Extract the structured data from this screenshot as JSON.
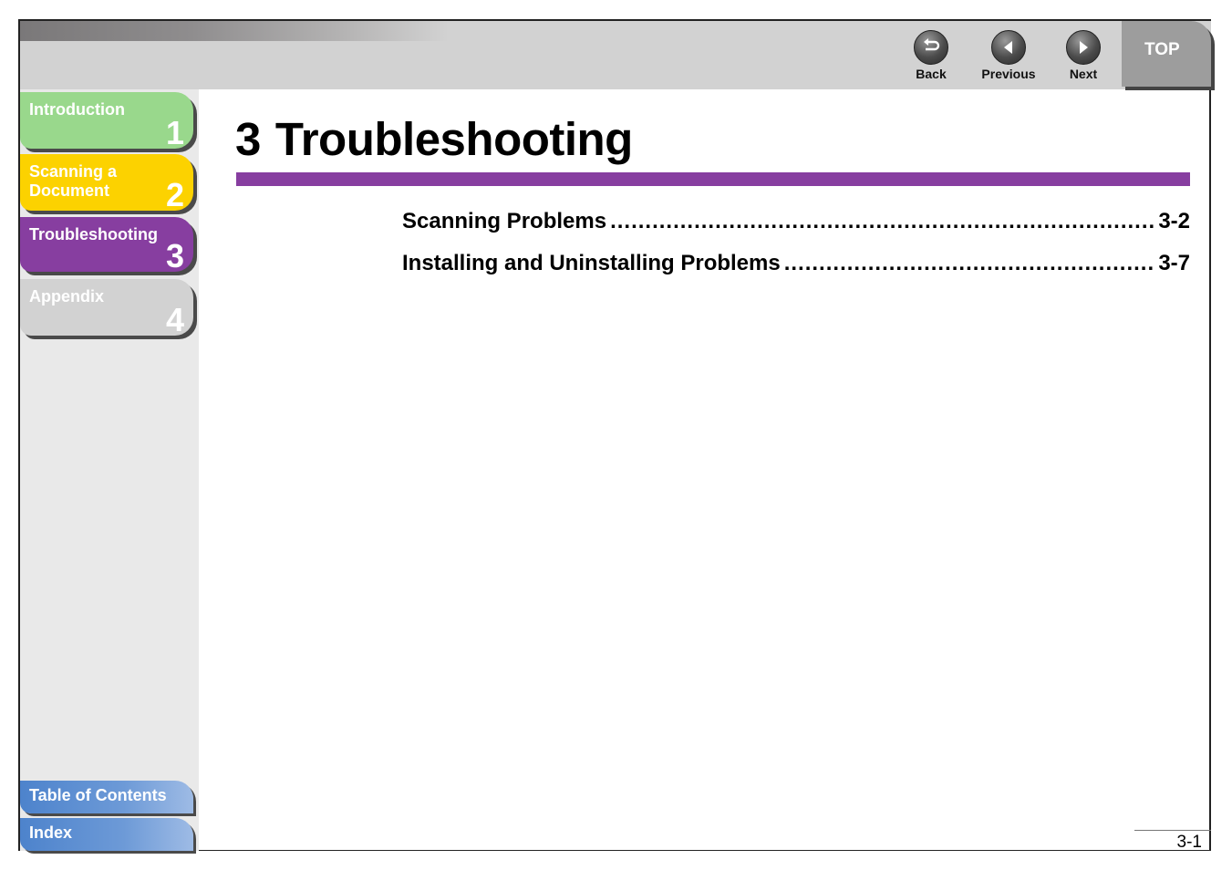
{
  "header": {
    "nav": {
      "back": "Back",
      "previous": "Previous",
      "next": "Next",
      "top": "TOP"
    }
  },
  "sidebar": {
    "chapters": [
      {
        "label": "Introduction",
        "number": "1",
        "color": "#99d88c"
      },
      {
        "label": "Scanning a Document",
        "line1": "Scanning a",
        "line2": "Document",
        "number": "2",
        "color": "#fcd200"
      },
      {
        "label": "Troubleshooting",
        "number": "3",
        "color": "#873ea0"
      },
      {
        "label": "Appendix",
        "number": "4",
        "color": "#d2d2d2"
      }
    ],
    "bottom_links": [
      {
        "label": "Table of Contents"
      },
      {
        "label": "Index"
      }
    ]
  },
  "main": {
    "chapter_number": "3",
    "chapter_title": "Troubleshooting",
    "accent_color": "#873ea0",
    "toc": [
      {
        "title": "Scanning Problems",
        "page": "3-2"
      },
      {
        "title": "Installing and Uninstalling Problems",
        "page": "3-7"
      }
    ]
  },
  "footer": {
    "page_number": "3-1"
  }
}
